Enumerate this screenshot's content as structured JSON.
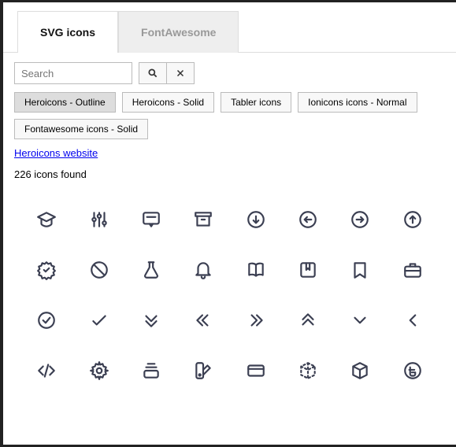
{
  "tabs": [
    {
      "label": "SVG icons",
      "active": true
    },
    {
      "label": "FontAwesome",
      "active": false
    }
  ],
  "search": {
    "placeholder": "Search",
    "value": ""
  },
  "filters": [
    {
      "label": "Heroicons - Outline",
      "active": true
    },
    {
      "label": "Heroicons - Solid",
      "active": false
    },
    {
      "label": "Tabler icons",
      "active": false
    },
    {
      "label": "Ionicons icons - Normal",
      "active": false
    },
    {
      "label": "Fontawesome icons - Solid",
      "active": false
    }
  ],
  "website_link": "Heroicons website",
  "count_text": "226 icons found",
  "icons": [
    "academic-cap",
    "adjustments",
    "annotation",
    "archive",
    "arrow-circle-down",
    "arrow-circle-left",
    "arrow-circle-right",
    "arrow-circle-up",
    "badge-check",
    "ban",
    "beaker",
    "bell",
    "book-open",
    "bookmark-alt",
    "bookmark",
    "briefcase",
    "check-circle",
    "check",
    "chevron-double-down",
    "chevron-double-left",
    "chevron-double-right",
    "chevron-double-up",
    "chevron-down",
    "chevron-left",
    "code",
    "cog",
    "collection",
    "color-swatch",
    "credit-card",
    "cube-transparent",
    "cube",
    "currency-bangladeshi"
  ]
}
